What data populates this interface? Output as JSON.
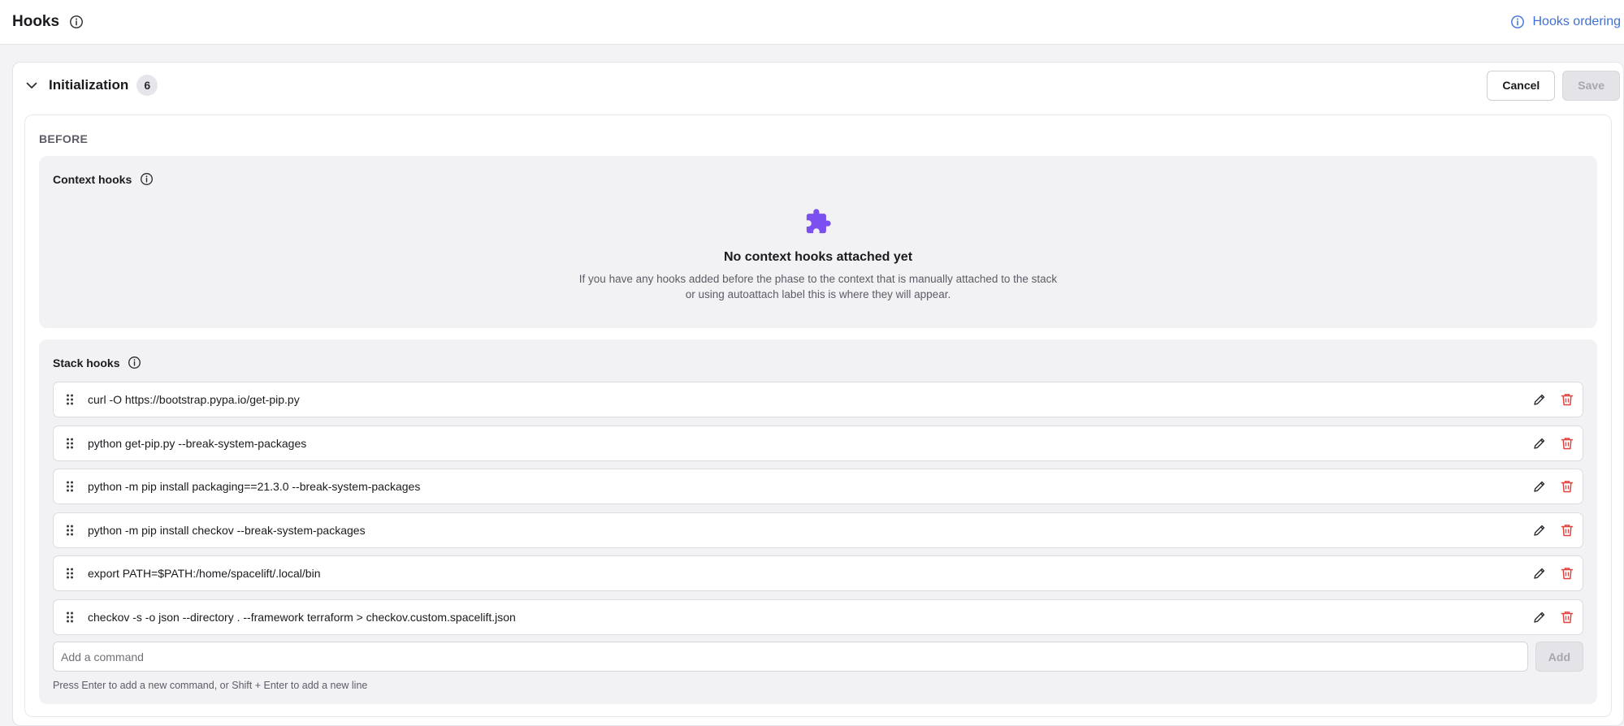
{
  "header": {
    "title": "Hooks",
    "hooks_ordering_label": "Hooks ordering"
  },
  "phase": {
    "title": "Initialization",
    "count": "6",
    "cancel_label": "Cancel",
    "save_label": "Save",
    "before_label": "BEFORE"
  },
  "context_hooks": {
    "title": "Context hooks",
    "empty_title": "No context hooks attached yet",
    "empty_desc_line1": "If you have any hooks added before the phase to the context that is manually attached to the stack",
    "empty_desc_line2": "or using autoattach label this is where they will appear."
  },
  "stack_hooks": {
    "title": "Stack hooks",
    "items": [
      "curl -O https://bootstrap.pypa.io/get-pip.py",
      "python get-pip.py --break-system-packages",
      "python -m pip install packaging==21.3.0 --break-system-packages",
      "python -m pip install checkov --break-system-packages",
      "export PATH=$PATH:/home/spacelift/.local/bin",
      "checkov -s -o json --directory . --framework terraform > checkov.custom.spacelift.json"
    ],
    "add_placeholder": "Add a command",
    "add_value": "",
    "add_label": "Add",
    "help_text": "Press Enter to add a new command, or Shift + Enter to add a new line"
  },
  "colors": {
    "accent_blue": "#3f6fd8",
    "puzzle_purple": "#7b4ff0",
    "delete_red": "#e0433f"
  },
  "icons": {
    "info": "info-circle-icon",
    "chevron": "chevron-down-icon",
    "puzzle": "puzzle-icon",
    "drag": "drag-handle-icon",
    "edit": "pencil-icon",
    "delete": "trash-icon"
  }
}
